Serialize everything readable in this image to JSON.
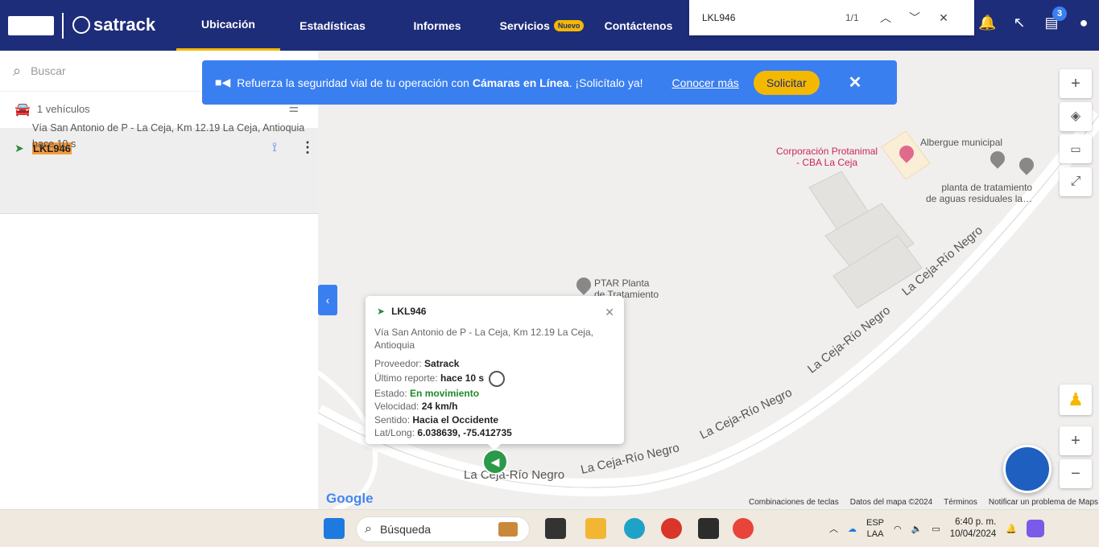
{
  "topbar": {
    "brand": "satrack",
    "nav": [
      {
        "label": "Ubicación",
        "active": true
      },
      {
        "label": "Estadísticas",
        "active": false
      },
      {
        "label": "Informes",
        "active": false
      },
      {
        "label": "Servicios",
        "badge": "Nuevo",
        "active": false
      },
      {
        "label": "Contáctenos",
        "active": false
      }
    ],
    "find": {
      "query": "LKL946",
      "count": "1/1"
    },
    "notifications_count": "3"
  },
  "sidebar": {
    "search_placeholder": "Buscar",
    "vehicle_count": "1 vehículos",
    "vehicle": {
      "plate": "LKL946",
      "address": "Vía San Antonio de P - La Ceja, Km 12.19 La Ceja, Antioquia",
      "time": "hace 10 s"
    }
  },
  "banner": {
    "text_pre": "Refuerza la seguridad vial de tu operación con ",
    "text_bold": "Cámaras en Línea",
    "text_post": ". ¡Solicítalo ya!",
    "link": "Conocer más",
    "button": "Solicitar"
  },
  "popup": {
    "plate": "LKL946",
    "address": "Vía San Antonio de P - La Ceja, Km 12.19 La Ceja, Antioquia",
    "rows": [
      {
        "label": "Proveedor:",
        "value": "Satrack"
      },
      {
        "label": "Último reporte:",
        "value": "hace 10 s"
      },
      {
        "label": "Estado:",
        "value": "En movimiento"
      },
      {
        "label": "Velocidad:",
        "value": "24 km/h"
      },
      {
        "label": "Sentido:",
        "value": "Hacia el Occidente"
      },
      {
        "label": "Lat/Long:",
        "value": "6.038639, -75.412735"
      }
    ]
  },
  "map": {
    "road_labels": [
      "La Ceja-Río Negro",
      "La Ceja-Río Negro",
      "La Ceja-Río Negro",
      "La Ceja-Río Negro",
      "La Ceja-Río Negro"
    ],
    "pois": [
      {
        "name": "Corporación Protanimal\n- CBA La Ceja"
      },
      {
        "name": "Albergue municipal"
      },
      {
        "name": "planta de tratamiento\nde aguas residuales la…"
      },
      {
        "name": "PTAR Planta\nde Tratamiento"
      }
    ],
    "google": "Google",
    "footer": [
      "Combinaciones de teclas",
      "Datos del mapa ©2024",
      "Términos",
      "Notificar un problema de Maps"
    ]
  },
  "taskbar": {
    "search": "Búsqueda",
    "lang1": "ESP",
    "lang2": "LAA",
    "time": "6:40 p. m.",
    "date": "10/04/2024"
  },
  "colors": {
    "navy": "#1e2d7a",
    "accent": "#f5b800",
    "blue": "#3a7ff0",
    "green": "#2a9a4a"
  }
}
